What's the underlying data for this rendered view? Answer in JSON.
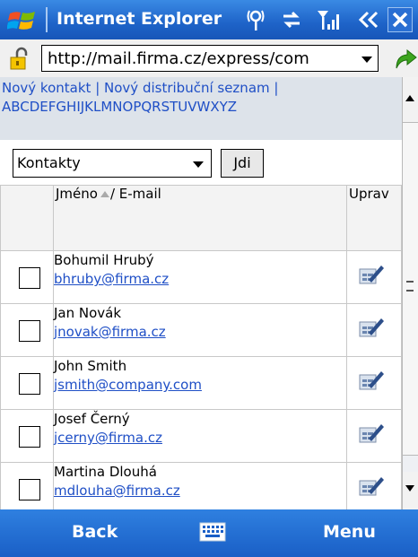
{
  "titlebar": {
    "app_title": "Internet Explorer",
    "icons": [
      "windows-logo-icon",
      "connectivity-icon",
      "sync-arrows-icon",
      "signal-strength-icon",
      "volume-icon",
      "close-icon"
    ]
  },
  "addressbar": {
    "url": "http://mail.firma.cz/express/com"
  },
  "links": {
    "new_contact": "Nový kontakt",
    "separator": "|",
    "new_distribution_list": "Nový distribuční seznam",
    "alphabet": "ABCDEFGHIJKLMNOPQRSTUVWXYZ"
  },
  "controls": {
    "folder_select_value": "Kontakty",
    "go_button": "Jdi"
  },
  "table": {
    "headers": {
      "name_part1": "Jméno",
      "name_part2": "/ E-mail",
      "edit": "Uprav"
    },
    "rows": [
      {
        "name": "Bohumil Hrubý",
        "email": "bhruby@firma.cz"
      },
      {
        "name": "Jan Novák",
        "email": "jnovak@firma.cz"
      },
      {
        "name": "John Smith",
        "email": "jsmith@company.com"
      },
      {
        "name": "Josef Černý",
        "email": "jcerny@firma.cz"
      },
      {
        "name": "Martina Dlouhá",
        "email": "mdlouha@firma.cz"
      }
    ]
  },
  "bottombar": {
    "left_softkey": "Back",
    "right_softkey": "Menu"
  },
  "colors": {
    "title_blue": "#1e63c8",
    "link_blue": "#1f4fc6",
    "links_background": "#dde3ea"
  }
}
